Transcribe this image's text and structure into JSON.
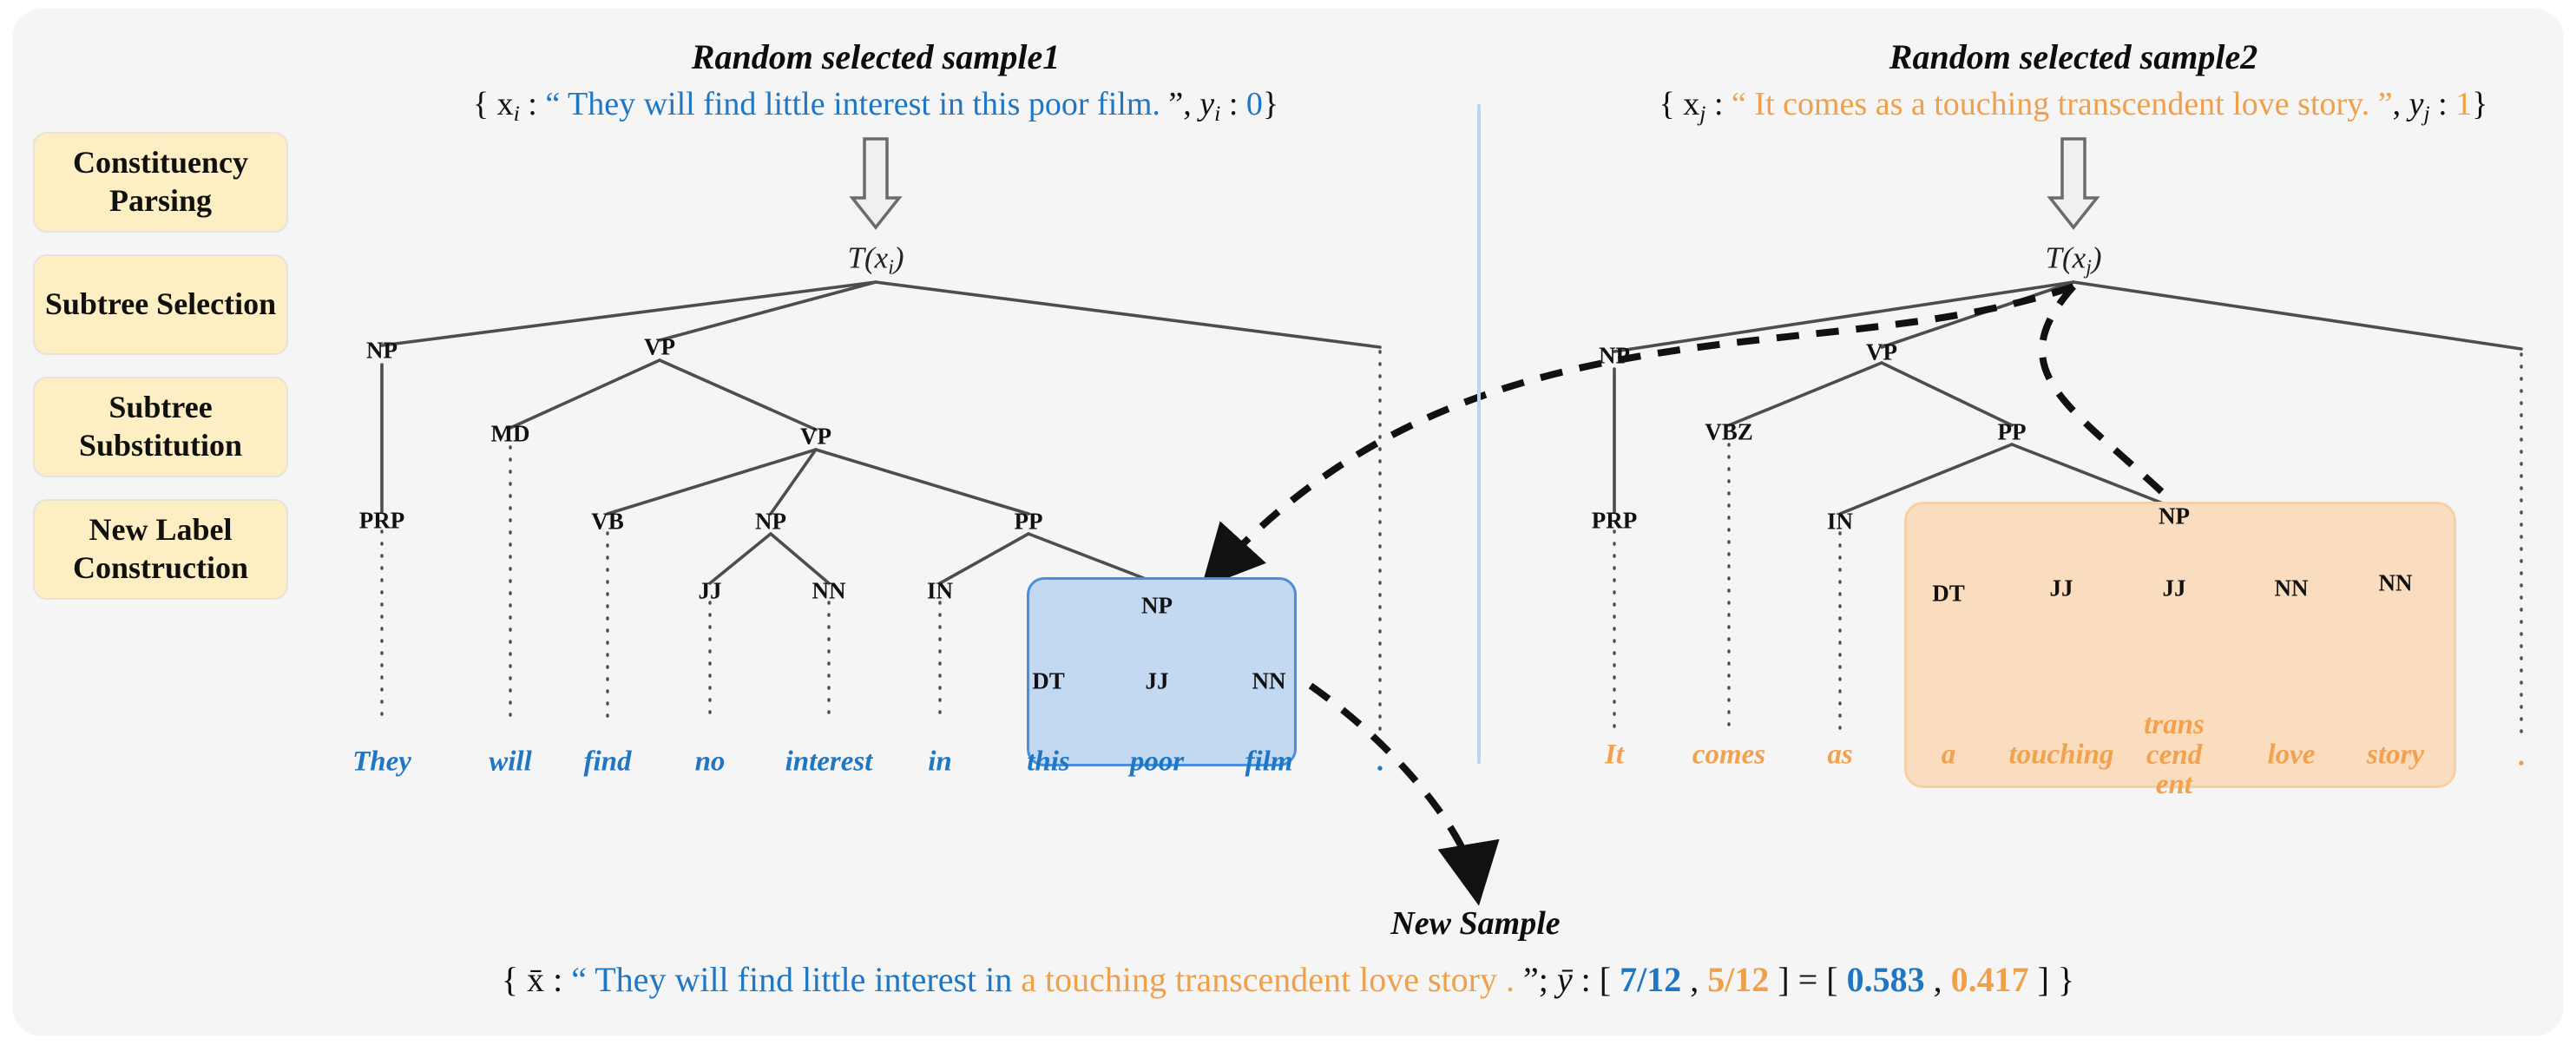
{
  "pipeline": {
    "steps": [
      {
        "label": "Constituency Parsing"
      },
      {
        "label": "Subtree Selection"
      },
      {
        "label": "Subtree Substitution"
      },
      {
        "label": "New Label Construction"
      }
    ]
  },
  "colors": {
    "blue": "#1f77c4",
    "orange": "#f0a04b",
    "box_yellow": "#fdeec4",
    "highlight_blue_fill": "#c3d9f2",
    "highlight_blue_stroke": "#4b8fdc",
    "highlight_orange_fill": "#fadcbe",
    "highlight_orange_stroke": "#f7cfa6",
    "panel_bg": "#f5f5f6"
  },
  "sample1": {
    "title": "Random selected sample1",
    "open_brace": "{",
    "var": "x",
    "var_sub": "i",
    "colon": " : ",
    "quote_open": "“ ",
    "sentence": "They will find little interest in this poor film.",
    "quote_close": " ”",
    "comma": ", ",
    "label_var": "y",
    "label_var_sub": "i",
    "label_value": "0",
    "close_brace": "}",
    "root_label": "T(x",
    "root_sub": "i",
    "root_close": ")",
    "nodes": [
      {
        "id": "NP1",
        "label": "NP"
      },
      {
        "id": "VP1",
        "label": "VP"
      },
      {
        "id": "MD",
        "label": "MD"
      },
      {
        "id": "VP2",
        "label": "VP"
      },
      {
        "id": "PRP",
        "label": "PRP"
      },
      {
        "id": "VB",
        "label": "VB"
      },
      {
        "id": "NP2",
        "label": "NP"
      },
      {
        "id": "PP",
        "label": "PP"
      },
      {
        "id": "JJ",
        "label": "JJ"
      },
      {
        "id": "NN",
        "label": "NN"
      },
      {
        "id": "IN",
        "label": "IN"
      },
      {
        "id": "NP3",
        "label": "NP"
      },
      {
        "id": "DT3",
        "label": "DT"
      },
      {
        "id": "JJ3",
        "label": "JJ"
      },
      {
        "id": "NN3",
        "label": "NN"
      }
    ],
    "leaves": [
      {
        "word": "They"
      },
      {
        "word": "will"
      },
      {
        "word": "find"
      },
      {
        "word": "no"
      },
      {
        "word": "interest"
      },
      {
        "word": "in"
      },
      {
        "word": "this"
      },
      {
        "word": "poor"
      },
      {
        "word": "film"
      },
      {
        "word": "."
      }
    ]
  },
  "sample2": {
    "title": "Random selected sample2",
    "open_brace": "{",
    "var": "x",
    "var_sub": "j",
    "colon": " : ",
    "quote_open": "“ ",
    "sentence": "It comes as a touching transcendent love story.",
    "quote_close": " ”",
    "comma": ", ",
    "label_var": "y",
    "label_var_sub": "j",
    "label_value": "1",
    "close_brace": "}",
    "root_label": "T(x",
    "root_sub": "j",
    "root_close": ")",
    "nodes": [
      {
        "id": "NP1",
        "label": "NP"
      },
      {
        "id": "VP1",
        "label": "VP"
      },
      {
        "id": "PRP",
        "label": "PRP"
      },
      {
        "id": "VBZ",
        "label": "VBZ"
      },
      {
        "id": "PP",
        "label": "PP"
      },
      {
        "id": "IN",
        "label": "IN"
      },
      {
        "id": "NPsel",
        "label": "NP"
      },
      {
        "id": "DT",
        "label": "DT"
      },
      {
        "id": "JJa",
        "label": "JJ"
      },
      {
        "id": "JJb",
        "label": "JJ"
      },
      {
        "id": "NNa",
        "label": "NN"
      },
      {
        "id": "NNb",
        "label": "NN"
      }
    ],
    "leaves": [
      {
        "word": "It"
      },
      {
        "word": "comes"
      },
      {
        "word": "as"
      },
      {
        "word": "a"
      },
      {
        "word": "touching"
      },
      {
        "word": "trans",
        "word2": "cend",
        "word3": "ent"
      },
      {
        "word": "love"
      },
      {
        "word": "story"
      },
      {
        "word": "."
      }
    ]
  },
  "new_sample": {
    "title": "New Sample",
    "open_brace": "{",
    "var": "x̄",
    "colon": " : ",
    "quote_open": "“ ",
    "part_blue": "They will find little interest in ",
    "part_orange": "a touching transcendent love story",
    "period": " . ",
    "quote_close": "”",
    "semicolon": "; ",
    "label_var": "ȳ",
    "label_colon": " : ",
    "bracket_open": "[ ",
    "frac_blue": "7/12",
    "frac_sep": " , ",
    "frac_orange": "5/12",
    "bracket_close": " ]",
    "equals": " = ",
    "dec_bracket_open": "[ ",
    "dec_blue": "0.583",
    "dec_sep": " , ",
    "dec_orange": "0.417",
    "dec_bracket_close": " ]",
    "close_brace": " }"
  }
}
